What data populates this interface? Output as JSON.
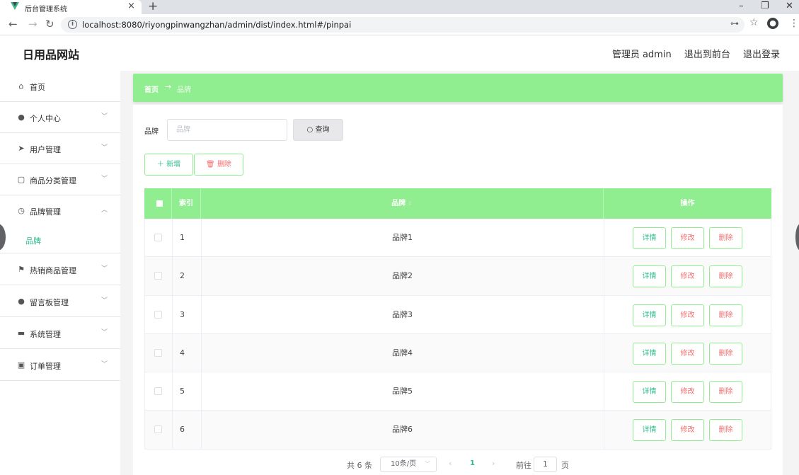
{
  "browser": {
    "tab_title": "后台管理系统",
    "url": "localhost:8080/riyongpinwangzhan/admin/dist/index.html#/pinpai"
  },
  "header": {
    "site_title": "日用品网站",
    "user_label": "管理员 admin",
    "to_front": "退出到前台",
    "logout": "退出登录"
  },
  "sidebar": {
    "items": [
      {
        "label": "首页",
        "icon": "home-icon"
      },
      {
        "label": "个人中心",
        "icon": "user-icon"
      },
      {
        "label": "用户管理",
        "icon": "send-icon"
      },
      {
        "label": "商品分类管理",
        "icon": "copy-icon"
      },
      {
        "label": "品牌管理",
        "icon": "clock-icon"
      },
      {
        "label": "热销商品管理",
        "icon": "flag-icon"
      },
      {
        "label": "留言板管理",
        "icon": "location-icon"
      },
      {
        "label": "系统管理",
        "icon": "suitcase-icon"
      },
      {
        "label": "订单管理",
        "icon": "clipboard-icon"
      }
    ],
    "sub_item": "品牌"
  },
  "breadcrumb": {
    "home": "首页",
    "separator": "→",
    "current": "品牌"
  },
  "search": {
    "label": "品牌",
    "placeholder": "品牌",
    "button": "查询"
  },
  "actions": {
    "add": "新增",
    "delete": "删除"
  },
  "table": {
    "headers": {
      "index": "索引",
      "brand": "品牌",
      "ops": "操作"
    },
    "rows": [
      {
        "index": "1",
        "brand": "品牌1"
      },
      {
        "index": "2",
        "brand": "品牌2"
      },
      {
        "index": "3",
        "brand": "品牌3"
      },
      {
        "index": "4",
        "brand": "品牌4"
      },
      {
        "index": "5",
        "brand": "品牌5"
      },
      {
        "index": "6",
        "brand": "品牌6"
      }
    ],
    "op_labels": {
      "detail": "详情",
      "edit": "修改",
      "delete": "删除"
    }
  },
  "pagination": {
    "total": "共 6 条",
    "page_size": "10条/页",
    "current_page": "1",
    "goto_label": "前往",
    "goto_value": "1",
    "page_suffix": "页"
  },
  "colors": {
    "accent": "#90ee90",
    "primary_text": "#2bbd8a",
    "danger": "#f56c6c"
  }
}
